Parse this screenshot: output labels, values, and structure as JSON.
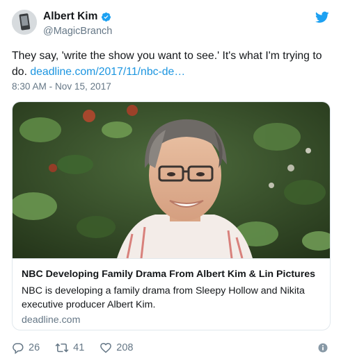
{
  "author": {
    "name": "Albert Kim",
    "handle": "@MagicBranch",
    "verified_icon": "verified-badge-icon",
    "avatar_icon": "avatar"
  },
  "platform_icon": "twitter-bird-icon",
  "tweet": {
    "text": "They say, 'write the show you want to see.' It's what I'm trying to do.",
    "link_text": "deadline.com/2017/11/nbc-de…",
    "timestamp": "8:30 AM - Nov 15, 2017"
  },
  "card": {
    "title": "NBC Developing Family Drama From Albert Kim & Lin Pictures",
    "description": "NBC is developing a family drama from Sleepy Hollow and Nikita executive producer Albert Kim.",
    "domain": "deadline.com"
  },
  "actions": {
    "replies": "26",
    "retweets": "41",
    "likes": "208"
  },
  "colors": {
    "accent": "#1da1f2",
    "link": "#1b95e0",
    "secondary_text": "#657786",
    "border": "#e1e8ed"
  }
}
